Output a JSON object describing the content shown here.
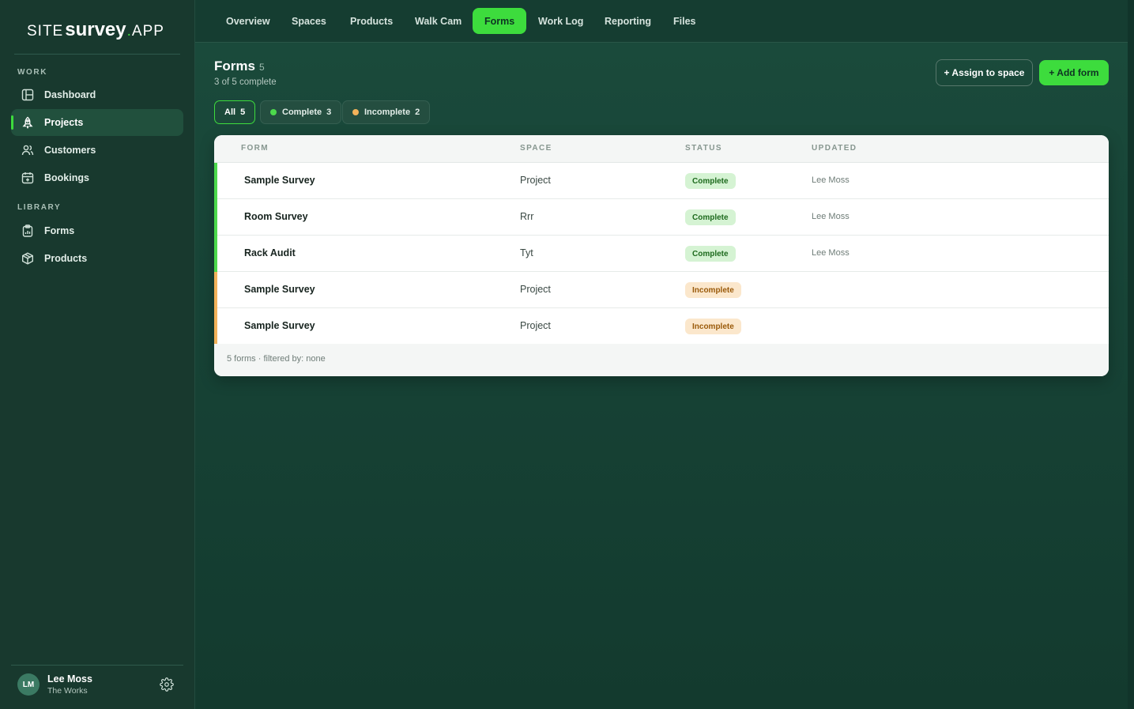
{
  "brand": {
    "site": "SITE",
    "survey": "survey",
    "dot": ".",
    "app": "APP"
  },
  "sidebar": {
    "sections": [
      {
        "label": "WORK"
      },
      {
        "label": "LIBRARY"
      }
    ],
    "items": [
      {
        "label": "Dashboard",
        "icon": "dashboard-icon"
      },
      {
        "label": "Projects",
        "icon": "rocket-icon",
        "active": true
      },
      {
        "label": "Customers",
        "icon": "users-icon"
      },
      {
        "label": "Bookings",
        "icon": "calendar-icon"
      },
      {
        "label": "Forms",
        "icon": "clipboard-icon"
      },
      {
        "label": "Products",
        "icon": "box-icon"
      }
    ],
    "user": {
      "initials": "LM",
      "name": "Lee Moss",
      "org": "The Works"
    }
  },
  "tabs": [
    {
      "label": "Overview"
    },
    {
      "label": "Spaces"
    },
    {
      "label": "Products"
    },
    {
      "label": "Walk Cam"
    },
    {
      "label": "Forms",
      "active": true
    },
    {
      "label": "Work Log"
    },
    {
      "label": "Reporting"
    },
    {
      "label": "Files"
    }
  ],
  "page": {
    "title": "Forms",
    "count": "5",
    "subtitle": "3 of 5 complete",
    "assign_label": "+ Assign to space",
    "add_label": "+ Add form"
  },
  "filters": [
    {
      "label": "All",
      "count": "5",
      "active": true
    },
    {
      "label": "Complete",
      "count": "3",
      "color": "#4cd94c"
    },
    {
      "label": "Incomplete",
      "count": "2",
      "color": "#f2b25a"
    }
  ],
  "table": {
    "headers": {
      "form": "FORM",
      "space": "SPACE",
      "status": "STATUS",
      "updated": "UPDATED"
    },
    "rows": [
      {
        "form": "Sample Survey",
        "space": "Project",
        "status": "Complete",
        "updated": "Lee Moss"
      },
      {
        "form": "Room Survey",
        "space": "Rrr",
        "status": "Complete",
        "updated": "Lee Moss"
      },
      {
        "form": "Rack Audit",
        "space": "Tyt",
        "status": "Complete",
        "updated": "Lee Moss"
      },
      {
        "form": "Sample Survey",
        "space": "Project",
        "status": "Incomplete",
        "updated": ""
      },
      {
        "form": "Sample Survey",
        "space": "Project",
        "status": "Incomplete",
        "updated": ""
      }
    ],
    "footer": "5 forms · filtered by: none"
  },
  "colors": {
    "accent": "#3ddc3d",
    "complete_bar": "#4cd94c",
    "incomplete_bar": "#f2b25a"
  }
}
